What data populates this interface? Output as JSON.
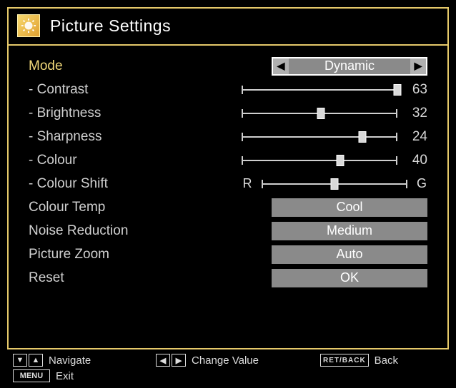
{
  "title": "Picture Settings",
  "mode": {
    "label": "Mode",
    "value": "Dynamic"
  },
  "sliders": {
    "contrast": {
      "label": "Contrast",
      "value": 63,
      "min": 0,
      "max": 63
    },
    "brightness": {
      "label": "Brightness",
      "value": 32,
      "min": 0,
      "max": 63
    },
    "sharpness": {
      "label": "Sharpness",
      "value": 24,
      "min": 0,
      "max": 31
    },
    "colour": {
      "label": "Colour",
      "value": 40,
      "min": 0,
      "max": 63
    },
    "colourShift": {
      "label": "Colour Shift",
      "value": 0,
      "min": -10,
      "max": 10,
      "leftLetter": "R",
      "rightLetter": "G"
    }
  },
  "selects": {
    "colourTemp": {
      "label": "Colour Temp",
      "value": "Cool"
    },
    "noiseReduction": {
      "label": "Noise Reduction",
      "value": "Medium"
    },
    "pictureZoom": {
      "label": "Picture Zoom",
      "value": "Auto"
    },
    "reset": {
      "label": "Reset",
      "value": "OK"
    }
  },
  "footer": {
    "navigate": "Navigate",
    "changeValue": "Change Value",
    "back": "Back",
    "backKey": "RET/BACK",
    "exit": "Exit",
    "menuKey": "MENU"
  }
}
